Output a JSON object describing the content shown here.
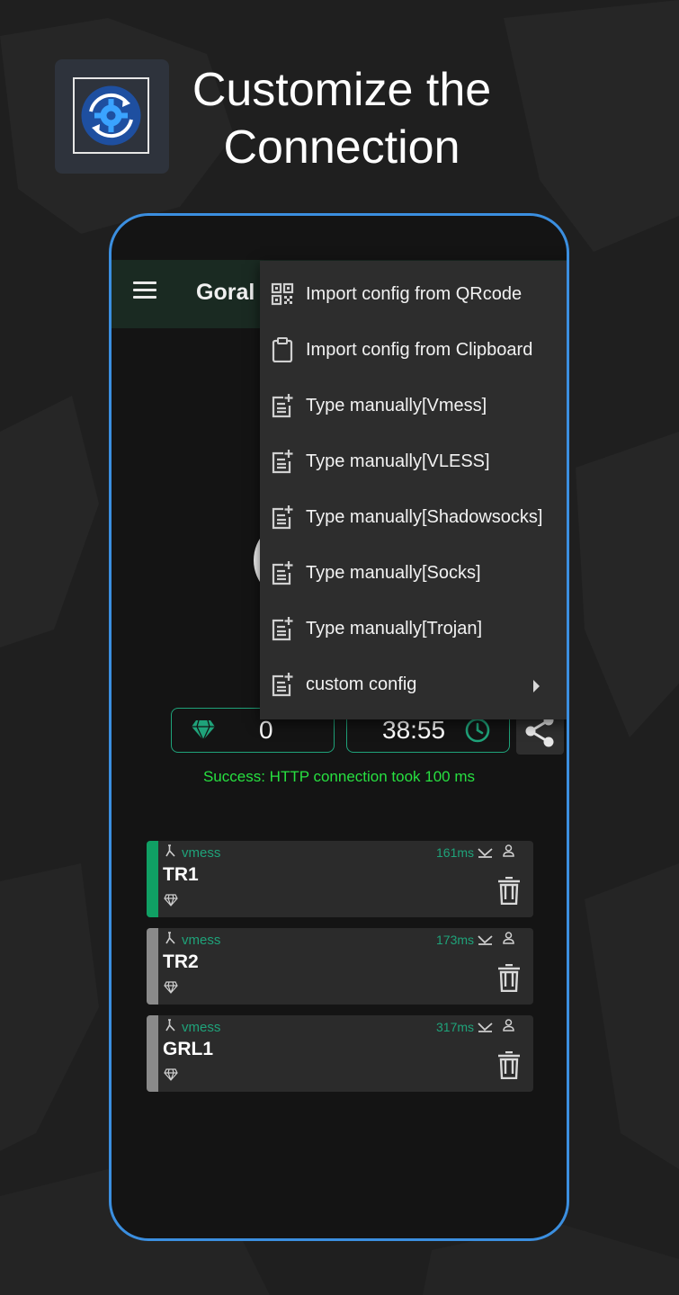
{
  "headline": {
    "line1": "Customize the",
    "line2": "Connection"
  },
  "colors": {
    "accent": "#1fa37a",
    "phone_border": "#3b8fe0",
    "status_text": "#27e040",
    "toolbar_bg": "#1a2a22",
    "selected_bar": "#10a064",
    "unselected_bar": "#8a8a8a"
  },
  "toolbar": {
    "title": "Goral",
    "menu_icon": "hamburger-menu-icon"
  },
  "menu": {
    "items": [
      {
        "label": "Import config from QRcode",
        "icon": "qrcode-icon"
      },
      {
        "label": "Import config from Clipboard",
        "icon": "clipboard-icon"
      },
      {
        "label": "Type manually[Vmess]",
        "icon": "note-add-icon"
      },
      {
        "label": "Type manually[VLESS]",
        "icon": "note-add-icon"
      },
      {
        "label": "Type manually[Shadowsocks]",
        "icon": "note-add-icon"
      },
      {
        "label": "Type manually[Socks]",
        "icon": "note-add-icon"
      },
      {
        "label": "Type manually[Trojan]",
        "icon": "note-add-icon"
      },
      {
        "label": "custom config",
        "icon": "note-add-icon",
        "submenu": true
      }
    ]
  },
  "stats": {
    "traffic_value": "0",
    "timer_value": "38:55"
  },
  "status": {
    "text": "Success: HTTP connection took 100 ms"
  },
  "servers": [
    {
      "protocol": "vmess",
      "name": "TR1",
      "ping": "161ms",
      "selected": true
    },
    {
      "protocol": "vmess",
      "name": "TR2",
      "ping": "173ms",
      "selected": false
    },
    {
      "protocol": "vmess",
      "name": "GRL1",
      "ping": "317ms",
      "selected": false
    }
  ]
}
